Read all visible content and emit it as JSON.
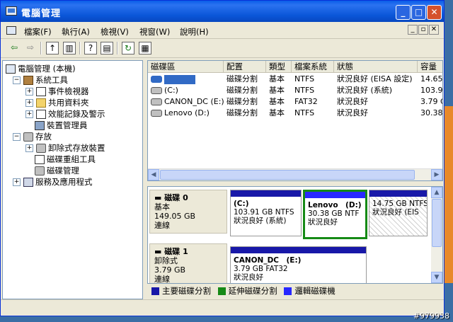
{
  "window": {
    "title": "電腦管理"
  },
  "menu": [
    "檔案(F)",
    "執行(A)",
    "檢視(V)",
    "視窗(W)",
    "說明(H)"
  ],
  "tree": {
    "root": "電腦管理 (本機)",
    "system_tools": "系統工具",
    "event_viewer": "事件檢視器",
    "shared_folders": "共用資料夾",
    "perf_logs": "效能記錄及警示",
    "device_manager": "裝置管理員",
    "storage": "存放",
    "removable_storage": "卸除式存放裝置",
    "defrag": "磁碟重組工具",
    "disk_mgmt": "磁碟管理",
    "services": "服務及應用程式"
  },
  "volumes": {
    "headers": [
      "磁碟區",
      "配置",
      "類型",
      "檔案系統",
      "狀態",
      "容量"
    ],
    "rows": [
      {
        "name": "",
        "layout": "磁碟分割",
        "type": "基本",
        "fs": "NTFS",
        "status": "狀況良好 (EISA 設定)",
        "capacity": "14.65"
      },
      {
        "name": "(C:)",
        "layout": "磁碟分割",
        "type": "基本",
        "fs": "NTFS",
        "status": "狀況良好 (系統)",
        "capacity": "103.91"
      },
      {
        "name": "CANON_DC (E:)",
        "layout": "磁碟分割",
        "type": "基本",
        "fs": "FAT32",
        "status": "狀況良好",
        "capacity": "3.79 G"
      },
      {
        "name": "Lenovo (D:)",
        "layout": "磁碟分割",
        "type": "基本",
        "fs": "NTFS",
        "status": "狀況良好",
        "capacity": "30.38"
      }
    ]
  },
  "disks": [
    {
      "name": "磁碟 0",
      "kind": "基本",
      "size": "149.05 GB",
      "state": "連線",
      "parts": [
        {
          "label": "(C:)",
          "size": "103.91 GB NTFS",
          "status": "狀況良好 (系統)"
        },
        {
          "label": "Lenovo　(D:)",
          "size": "30.38 GB NTF",
          "status": "狀況良好"
        },
        {
          "label": "",
          "size": "14.75 GB NTFS",
          "status": "狀況良好 (EIS"
        }
      ]
    },
    {
      "name": "磁碟 1",
      "kind": "卸除式",
      "size": "3.79 GB",
      "state": "連線",
      "parts": [
        {
          "label": "CANON_DC　(E:)",
          "size": "3.79 GB FAT32",
          "status": "狀況良好"
        }
      ]
    }
  ],
  "legend": [
    "主要磁碟分割",
    "延伸磁碟分割",
    "邏輯磁碟機"
  ],
  "colors": {
    "primary": "#1818a8",
    "extended": "#168a16",
    "logical": "#2828ff",
    "titlebar": "#0a5ee8",
    "selection": "#316ac5"
  },
  "watermark": "#979938"
}
